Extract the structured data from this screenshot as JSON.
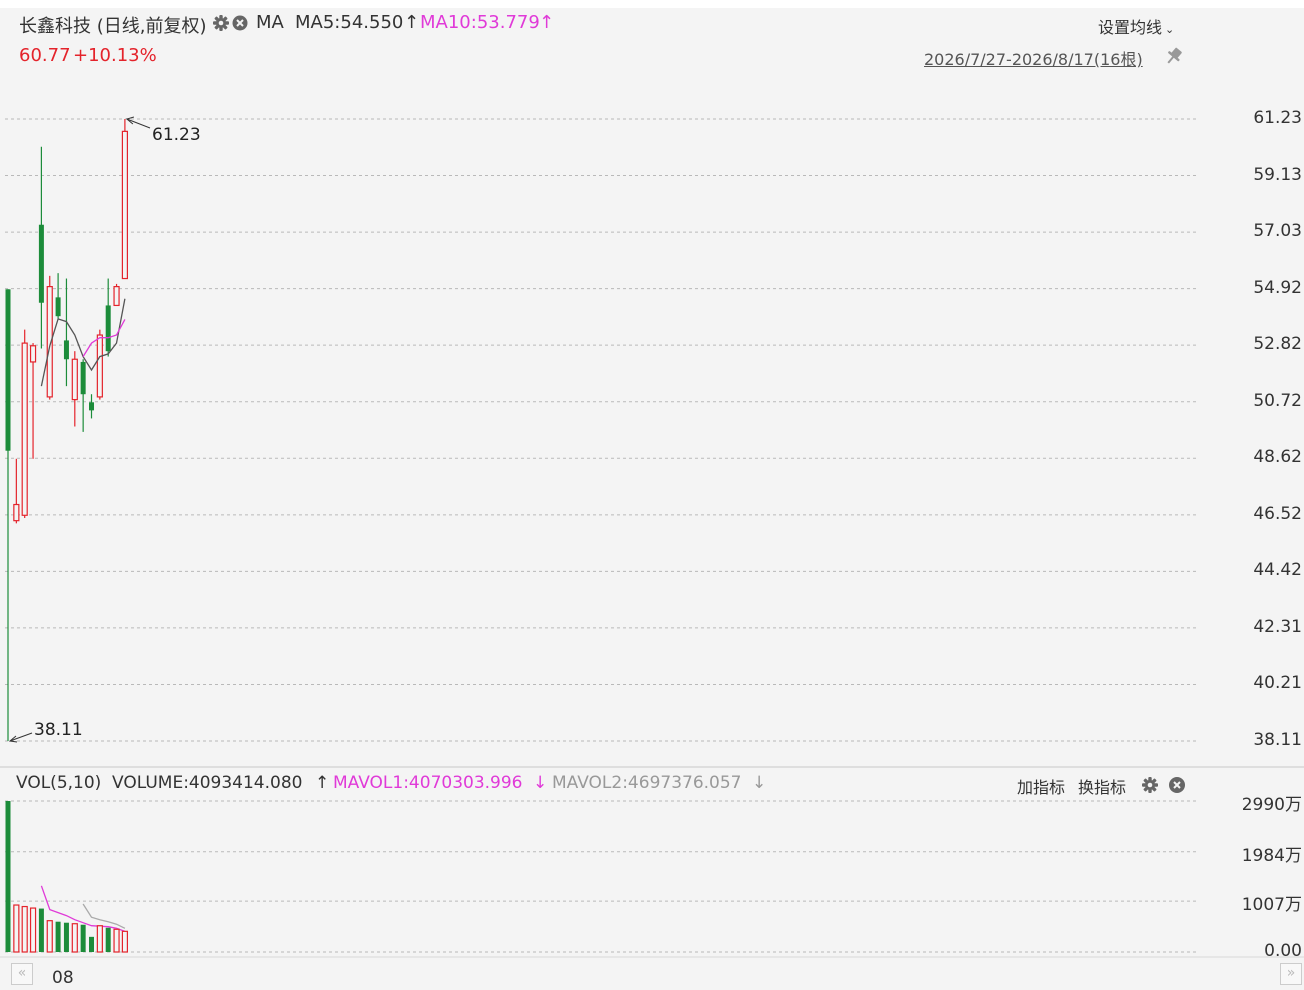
{
  "header": {
    "title": "长鑫科技 (日线,前复权)",
    "ma_label": "MA",
    "ma5": "MA5:54.550",
    "ma10": "MA10:53.779",
    "arrow_up": "↑",
    "price": "60.77",
    "change": "+10.13%",
    "setting": "设置均线",
    "range": "2026/7/27-2026/8/17(16根)"
  },
  "vol_header": {
    "label": "VOL(5,10)",
    "volume": "VOLUME:4093414.080",
    "mavol1": "MAVOL1:4070303.996",
    "mavol2": "MAVOL2:4697376.057",
    "arrow_up": "↑",
    "arrow_down": "↓",
    "add_indicator": "加指标",
    "switch_indicator": "换指标"
  },
  "x_axis_label": "08",
  "colors": {
    "up": "#e4232b",
    "down": "#1c8c3a",
    "ma5": "#555555",
    "ma10": "#e03ad8",
    "mavol2": "#aaaaaa"
  },
  "chart_data": {
    "type": "candlestick",
    "price_axis": {
      "min": 38.11,
      "max": 61.23,
      "ticks": [
        "61.23",
        "59.13",
        "57.03",
        "54.92",
        "52.82",
        "50.72",
        "48.62",
        "46.52",
        "44.42",
        "42.31",
        "40.21",
        "38.11"
      ]
    },
    "volume_axis": {
      "min": 0,
      "max": 2990,
      "unit": "万",
      "ticks": [
        "2990万",
        "1984万",
        "1007万",
        "0.00"
      ]
    },
    "annotations": {
      "high": "61.23",
      "low": "38.11"
    },
    "candles": [
      {
        "o": 54.9,
        "h": 54.9,
        "l": 38.11,
        "c": 48.9,
        "v": 2990
      },
      {
        "o": 46.3,
        "h": 48.6,
        "l": 46.2,
        "c": 46.9,
        "v": 930
      },
      {
        "o": 46.5,
        "h": 53.4,
        "l": 46.4,
        "c": 52.9,
        "v": 900
      },
      {
        "o": 52.2,
        "h": 52.9,
        "l": 48.6,
        "c": 52.8,
        "v": 870
      },
      {
        "o": 57.3,
        "h": 60.2,
        "l": 52.7,
        "c": 54.4,
        "v": 860
      },
      {
        "o": 50.9,
        "h": 55.4,
        "l": 50.8,
        "c": 55.0,
        "v": 620
      },
      {
        "o": 54.6,
        "h": 55.5,
        "l": 53.8,
        "c": 53.9,
        "v": 600
      },
      {
        "o": 53.0,
        "h": 55.3,
        "l": 51.3,
        "c": 52.3,
        "v": 580
      },
      {
        "o": 50.8,
        "h": 52.6,
        "l": 49.8,
        "c": 52.3,
        "v": 560
      },
      {
        "o": 52.2,
        "h": 52.3,
        "l": 49.6,
        "c": 51.0,
        "v": 540
      },
      {
        "o": 50.7,
        "h": 51.0,
        "l": 50.1,
        "c": 50.4,
        "v": 300
      },
      {
        "o": 50.9,
        "h": 53.4,
        "l": 50.8,
        "c": 53.2,
        "v": 520
      },
      {
        "o": 54.3,
        "h": 55.3,
        "l": 52.4,
        "c": 52.6,
        "v": 480
      },
      {
        "o": 54.3,
        "h": 55.1,
        "l": 54.3,
        "c": 55.0,
        "v": 450
      },
      {
        "o": 55.3,
        "h": 61.23,
        "l": 55.3,
        "c": 60.77,
        "v": 409
      }
    ],
    "ma5": [
      null,
      null,
      null,
      null,
      51.3,
      52.8,
      53.8,
      53.7,
      53.2,
      52.4,
      51.9,
      52.4,
      52.5,
      52.9,
      54.55
    ],
    "ma10": [
      null,
      null,
      null,
      null,
      null,
      null,
      null,
      null,
      null,
      52.4,
      52.9,
      53.1,
      53.1,
      53.2,
      53.78
    ],
    "mavol1": [
      null,
      null,
      null,
      null,
      1310,
      840,
      780,
      720,
      640,
      580,
      520,
      510,
      500,
      470,
      407
    ],
    "mavol2": [
      null,
      null,
      null,
      null,
      null,
      null,
      null,
      null,
      null,
      950,
      690,
      640,
      600,
      550,
      470
    ]
  }
}
